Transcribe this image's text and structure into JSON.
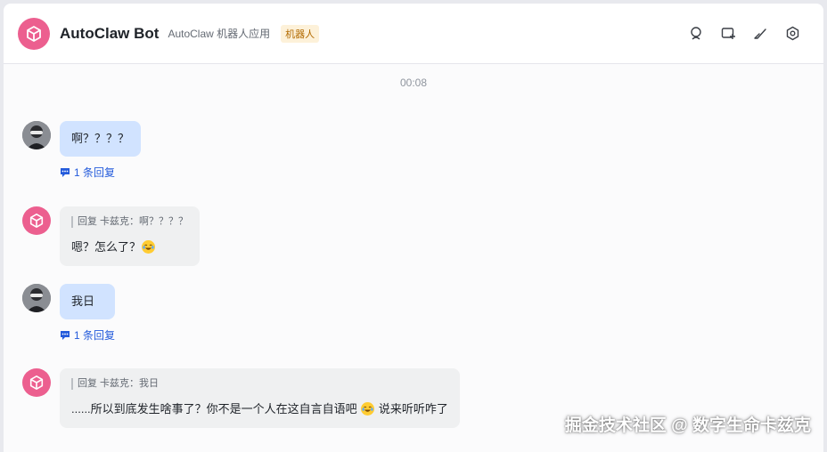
{
  "header": {
    "title": "AutoClaw Bot",
    "subtitle": "AutoClaw 机器人应用",
    "badge": "机器人",
    "actions": [
      "search-chat-icon",
      "add-tab-icon",
      "mark-done-icon",
      "settings-icon"
    ]
  },
  "chat": {
    "timestamp": "00:08",
    "messages": [
      {
        "sender": "user",
        "text": "啊？？？？",
        "reply_count": "1 条回复"
      },
      {
        "sender": "bot",
        "quote": "回复 卡兹克：啊？？？？",
        "text_before": "嗯？怎么了？",
        "emoji": "joy-emoji"
      },
      {
        "sender": "user",
        "text": "我日",
        "reply_count": "1 条回复"
      },
      {
        "sender": "bot",
        "quote": "回复 卡兹克：我日",
        "text_before": "......所以到底发生啥事了？你不是一个人在这自言自语吧 ",
        "emoji": "joy-emoji",
        "text_after": " 说来听听咋了"
      }
    ]
  },
  "watermark": "掘金技术社区 @ 数字生命卡兹克",
  "colors": {
    "bot_avatar": "#ec5f8f",
    "user_bubble": "#d1e3ff",
    "bot_bubble": "#eff0f1",
    "link": "#245bdb"
  }
}
